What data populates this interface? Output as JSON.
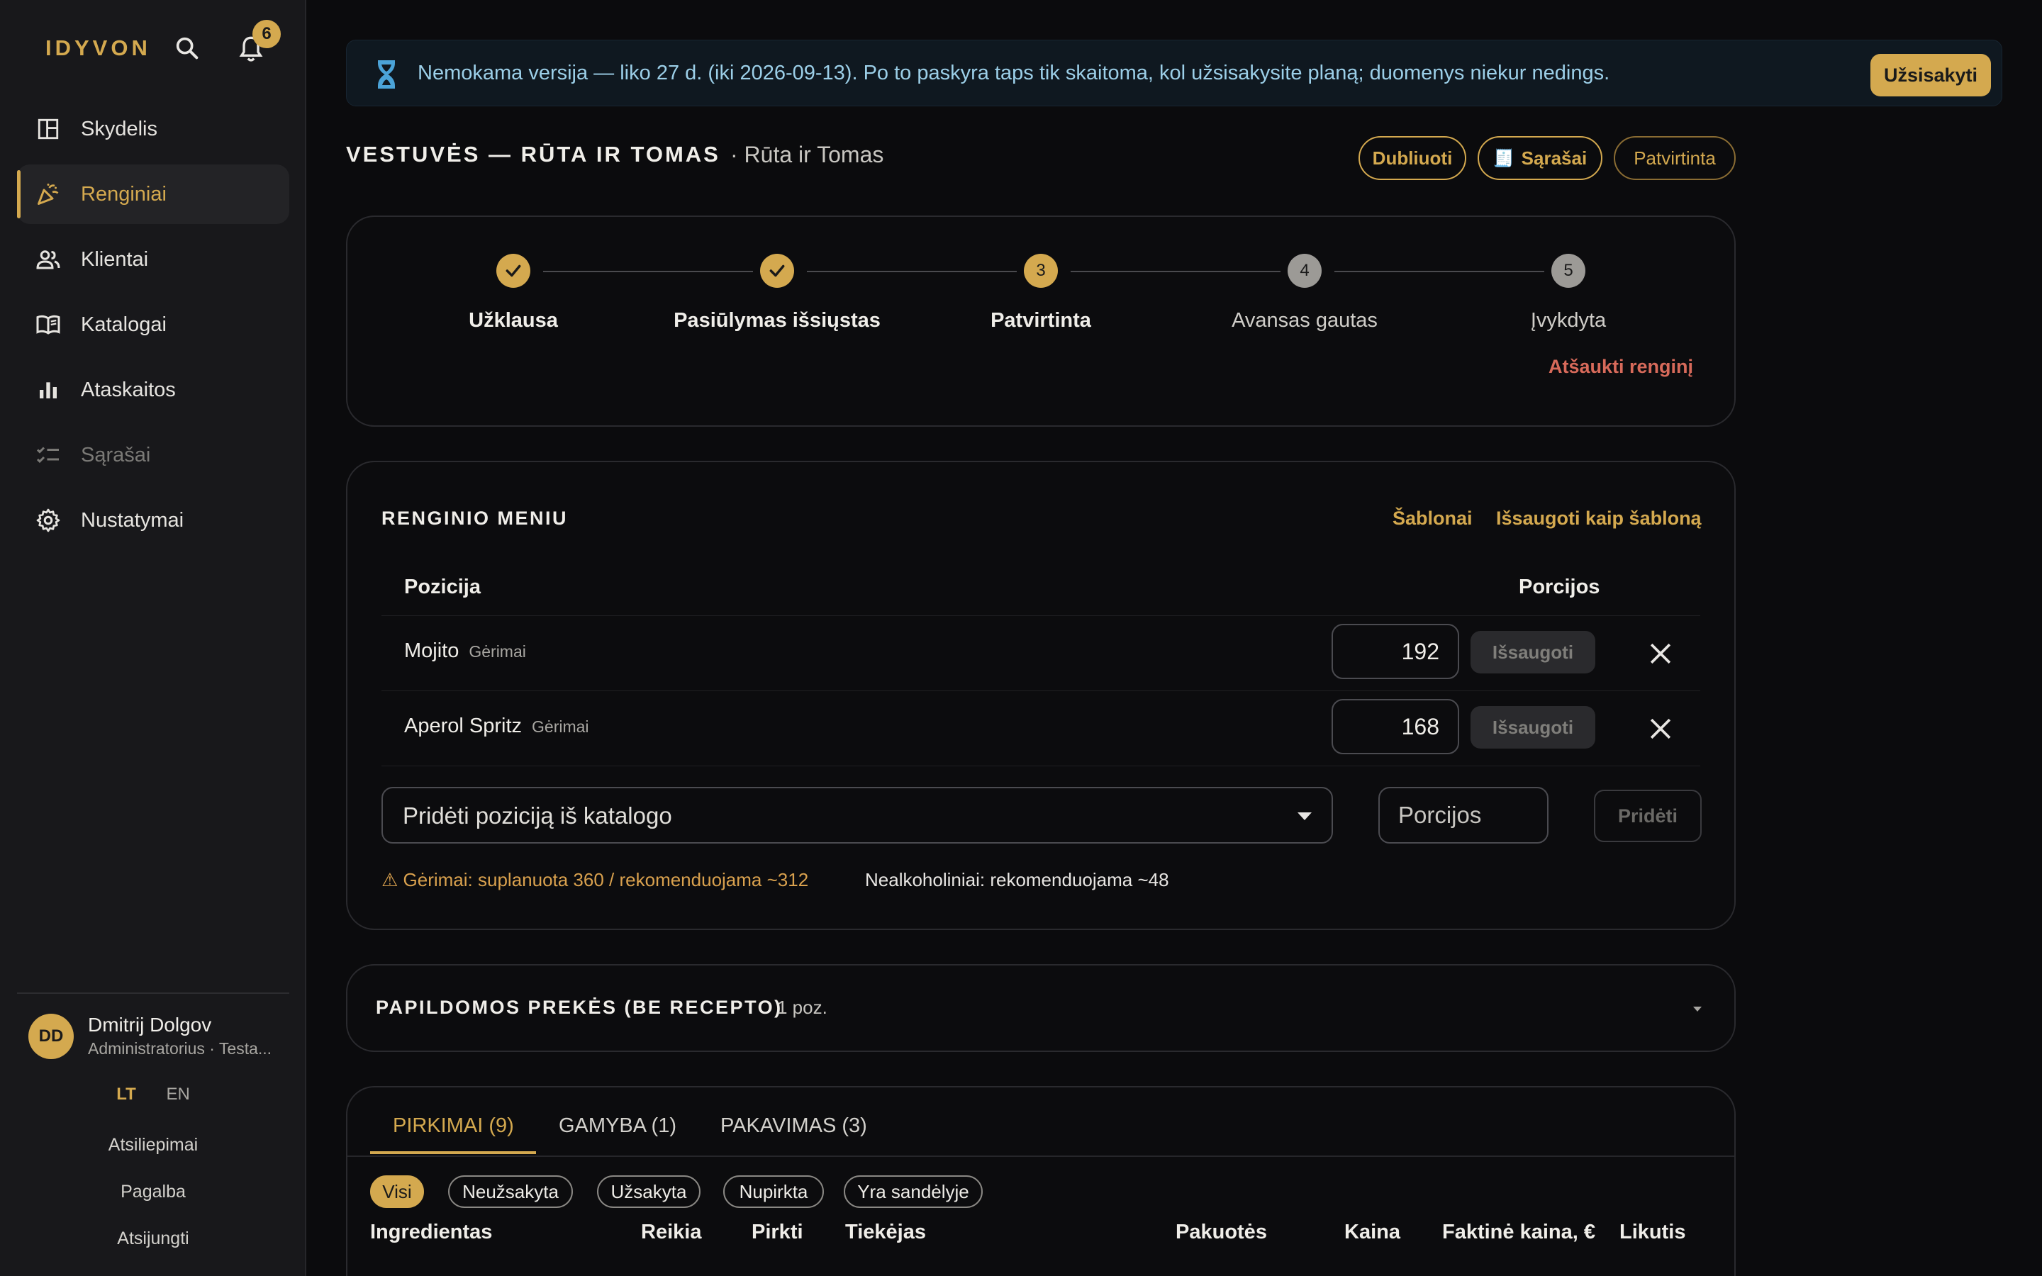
{
  "sidebar": {
    "logo": "IDYVON",
    "notifications_count": "6",
    "items": [
      {
        "label": "Skydelis",
        "icon": "dashboard-icon"
      },
      {
        "label": "Renginiai",
        "icon": "party-popper-icon"
      },
      {
        "label": "Klientai",
        "icon": "users-icon"
      },
      {
        "label": "Katalogai",
        "icon": "book-icon"
      },
      {
        "label": "Ataskaitos",
        "icon": "bar-chart-icon"
      },
      {
        "label": "Sąrašai",
        "icon": "checklist-icon"
      },
      {
        "label": "Nustatymai",
        "icon": "gear-icon"
      }
    ],
    "user": {
      "initials": "DD",
      "name": "Dmitrij Dolgov",
      "role": "Administratorius · Testa..."
    },
    "lang": {
      "lt": "LT",
      "en": "EN"
    },
    "links": {
      "feedback": "Atsiliepimai",
      "help": "Pagalba",
      "logout": "Atsijungti"
    }
  },
  "banner": {
    "text": "Nemokama versija — liko 27 d. (iki 2026-09-13). Po to paskyra taps tik skaitoma, kol užsisakysite planą; duomenys niekur nedings.",
    "button": "Užsisakyti",
    "icon": "hourglass-icon"
  },
  "header": {
    "title": "VESTUVĖS — RŪTA IR TOMAS",
    "subtitle": "· Rūta ir Tomas",
    "buttons": {
      "duplicate": "Dubliuoti",
      "lists": "Sąrašai",
      "lists_icon": "🧾",
      "status": "Patvirtinta"
    }
  },
  "stepper": {
    "steps": [
      {
        "label": "Užklausa",
        "number": "1",
        "state": "done"
      },
      {
        "label": "Pasiūlymas išsiųstas",
        "number": "2",
        "state": "done"
      },
      {
        "label": "Patvirtinta",
        "number": "3",
        "state": "current"
      },
      {
        "label": "Avansas gautas",
        "number": "4",
        "state": "todo"
      },
      {
        "label": "Įvykdyta",
        "number": "5",
        "state": "todo"
      }
    ],
    "cancel": "Atšaukti renginį"
  },
  "menu": {
    "title": "RENGINIO MENIU",
    "templates": "Šablonai",
    "save_template": "Išsaugoti kaip šabloną",
    "col_item": "Pozicija",
    "col_portions": "Porcijos",
    "rows": [
      {
        "name": "Mojito",
        "category": "Gėrimai",
        "qty": "192",
        "save": "Išsaugoti"
      },
      {
        "name": "Aperol Spritz",
        "category": "Gėrimai",
        "qty": "168",
        "save": "Išsaugoti"
      }
    ],
    "add_select": "Pridėti poziciją iš katalogo",
    "portions_placeholder": "Porcijos",
    "add_button": "Pridėti",
    "hint_warn": "⚠ Gėrimai: suplanuota 360 / rekomenduojama ~312",
    "hint_info": "Nealkoholiniai: rekomenduojama ~48"
  },
  "extras": {
    "title": "PAPILDOMOS PREKĖS (BE RECEPTO)",
    "count": "1 poz."
  },
  "tabs": {
    "items": [
      "PIRKIMAI (9)",
      "GAMYBA (1)",
      "PAKAVIMAS (3)"
    ],
    "chips": [
      "Visi",
      "Neužsakyta",
      "Užsakyta",
      "Nupirkta",
      "Yra sandėlyje"
    ],
    "columns": [
      "Ingredientas",
      "Reikia",
      "Pirkti",
      "Tiekėjas",
      "Pakuotės",
      "Kaina",
      "Faktinė kaina, €",
      "Likutis"
    ]
  },
  "colors": {
    "accent": "#d4a94f",
    "danger": "#d76a5a",
    "banner_text": "#9ccfe8"
  }
}
